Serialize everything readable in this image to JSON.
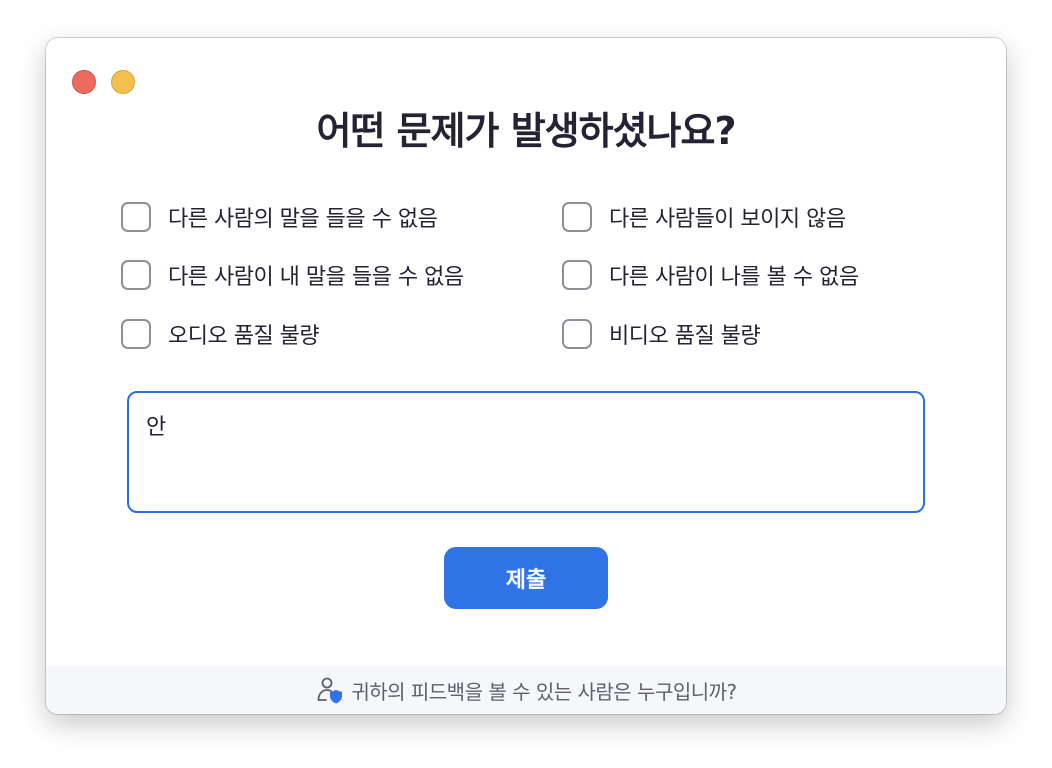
{
  "window": {
    "title": "어떤 문제가 발생하셨나요?"
  },
  "options": {
    "left": [
      {
        "label": "다른 사람의 말을 들을 수 없음",
        "checked": false
      },
      {
        "label": "다른 사람이 내 말을 들을 수 없음",
        "checked": false
      },
      {
        "label": "오디오 품질 불량",
        "checked": false
      }
    ],
    "right": [
      {
        "label": "다른 사람들이 보이지 않음",
        "checked": false
      },
      {
        "label": "다른 사람이 나를 볼 수 없음",
        "checked": false
      },
      {
        "label": "비디오 품질 불량",
        "checked": false
      }
    ]
  },
  "feedback": {
    "value": "안"
  },
  "submit": {
    "label": "제출"
  },
  "footer": {
    "text": "귀하의 피드백을 볼 수 있는 사람은 누구입니까?",
    "icon": "person-shield-icon"
  },
  "colors": {
    "accent": "#2f73e6",
    "close": "#ed6a5e",
    "minimize": "#f5bf4f",
    "text": "#232333"
  }
}
